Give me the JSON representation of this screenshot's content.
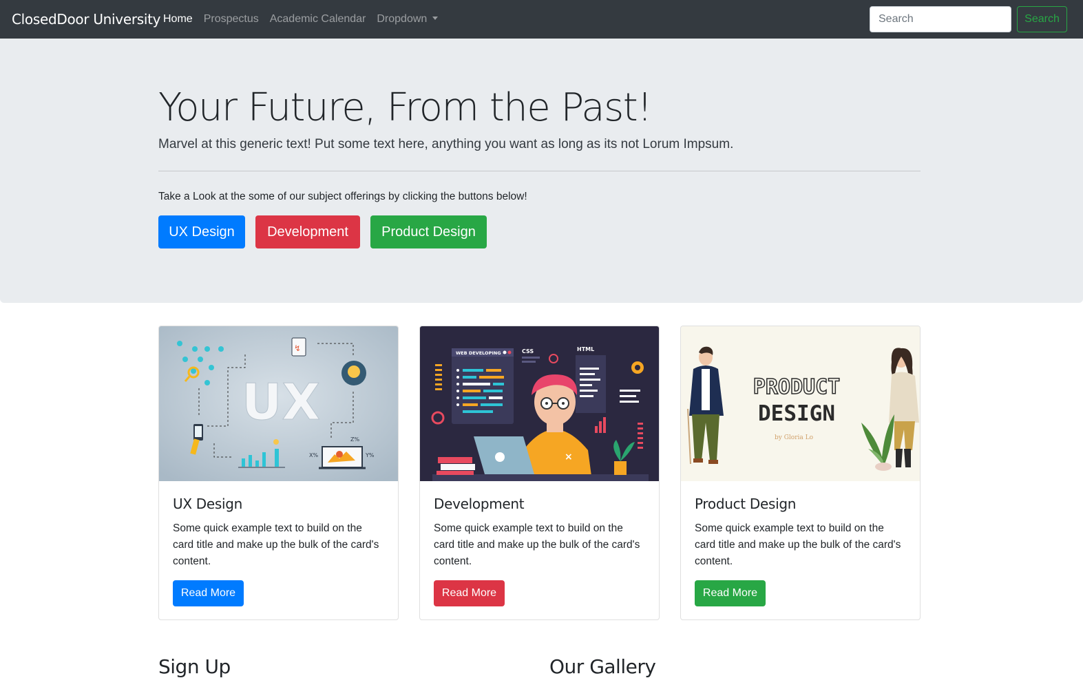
{
  "navbar": {
    "brand": "ClosedDoor University",
    "links": [
      {
        "label": "Home",
        "active": true
      },
      {
        "label": "Prospectus",
        "active": false
      },
      {
        "label": "Academic Calendar",
        "active": false
      },
      {
        "label": "Dropdown",
        "active": false
      }
    ],
    "search_placeholder": "Search",
    "search_button": "Search"
  },
  "jumbotron": {
    "title": "Your Future, From the Past!",
    "lead": "Marvel at this generic text! Put some text here, anything you want as long as its not Lorum Impsum.",
    "text": "Take a Look at the some of our subject offerings by clicking the buttons below!",
    "buttons": [
      {
        "label": "UX Design",
        "color": "#007bff"
      },
      {
        "label": "Development",
        "color": "#dc3545"
      },
      {
        "label": "Product Design",
        "color": "#28a745"
      }
    ]
  },
  "cards": [
    {
      "image_text": "UX",
      "title": "UX Design",
      "text": "Some quick example text to build on the card title and make up the bulk of the card's content.",
      "button": "Read More",
      "button_color": "#007bff"
    },
    {
      "image_labels": [
        "WEB DEVELOPING",
        "CSS",
        "HTML"
      ],
      "title": "Development",
      "text": "Some quick example text to build on the card title and make up the bulk of the card's content.",
      "button": "Read More",
      "button_color": "#dc3545"
    },
    {
      "image_labels": [
        "PRODUCT",
        "DESIGN",
        "by Gloria Lo"
      ],
      "title": "Product Design",
      "text": "Some quick example text to build on the card title and make up the bulk of the card's content.",
      "button": "Read More",
      "button_color": "#28a745"
    }
  ],
  "sections": {
    "signup": "Sign Up",
    "gallery": "Our Gallery"
  }
}
